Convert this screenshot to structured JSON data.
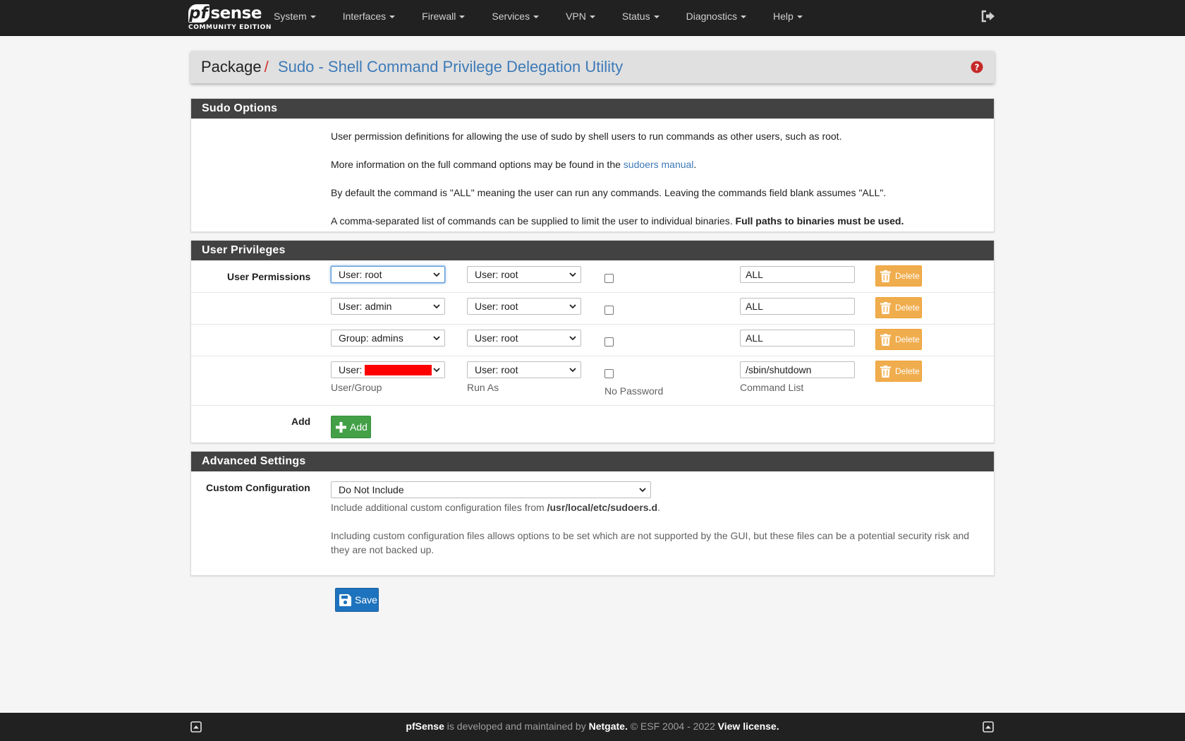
{
  "brand": {
    "name_pf": "pf",
    "name_sense": "sense",
    "edition": "COMMUNITY EDITION"
  },
  "nav": {
    "items": [
      "System",
      "Interfaces",
      "Firewall",
      "Services",
      "VPN",
      "Status",
      "Diagnostics",
      "Help"
    ],
    "logout_icon": "sign-out-icon"
  },
  "breadcrumb": {
    "package": "Package",
    "separator": "/",
    "current": "Sudo - Shell Command Privilege Delegation Utility"
  },
  "sudo_options": {
    "heading": "Sudo Options",
    "p1": "User permission definitions for allowing the use of sudo by shell users to run commands as other users, such as root.",
    "p2_before": "More information on the full command options may be found in the ",
    "p2_link": "sudoers manual",
    "p2_after": ".",
    "p3": "By default the command is \"ALL\" meaning the user can run any commands. Leaving the commands field blank assumes \"ALL\".",
    "p4_before": "A comma-separated list of commands can be supplied to limit the user to individual binaries. ",
    "p4_bold": "Full paths to binaries must be used."
  },
  "user_privileges": {
    "heading": "User Privileges",
    "label": "User Permissions",
    "rows": [
      {
        "user_group": "User: root",
        "run_as": "User: root",
        "no_password": false,
        "commands": "ALL",
        "delete": "Delete"
      },
      {
        "user_group": "User: admin",
        "run_as": "User: root",
        "no_password": false,
        "commands": "ALL",
        "delete": "Delete"
      },
      {
        "user_group": "Group: admins",
        "run_as": "User: root",
        "no_password": false,
        "commands": "ALL",
        "delete": "Delete"
      },
      {
        "user_group": "User:",
        "run_as": "User: root",
        "no_password": false,
        "commands": "/sbin/shutdown",
        "delete": "Delete"
      }
    ],
    "col_help": {
      "user_group": "User/Group",
      "run_as": "Run As",
      "no_password": "No Password",
      "commands": "Command List"
    },
    "add_label": "Add",
    "add_button": "Add"
  },
  "advanced": {
    "heading": "Advanced Settings",
    "label": "Custom Configuration",
    "select_value": "Do Not Include",
    "help1_before": "Include additional custom configuration files from ",
    "help1_bold": "/usr/local/etc/sudoers.d",
    "help1_after": ".",
    "help2_line1": "Including custom configuration files allows options to be set which are not supported by the GUI, but these files can be a potential security risk and",
    "help2_line2": "they are not backed up."
  },
  "save_button": "Save",
  "footer": {
    "brand": "pfSense",
    "middle": " is developed and maintained by ",
    "company": "Netgate.",
    "copyright": " © ESF 2004 - 2022 ",
    "license": "View license."
  },
  "colors": {
    "accent_link": "#3d7ab8",
    "warning": "#f0ad4e",
    "success": "#43a047",
    "primary": "#1e73be",
    "danger": "#d32f2f"
  }
}
